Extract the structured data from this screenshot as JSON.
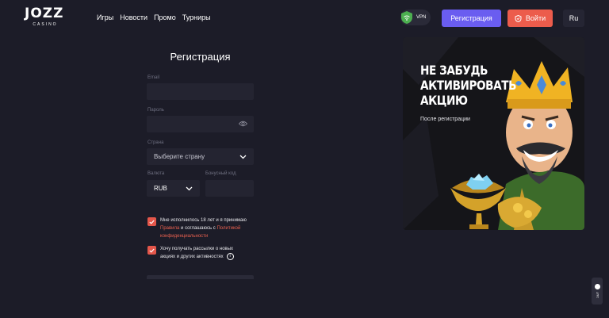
{
  "logo": {
    "main": "JOZZ",
    "sub": "CASINO"
  },
  "nav": [
    "Игры",
    "Новости",
    "Промо",
    "Турниры"
  ],
  "header": {
    "vpn_label": "VPN",
    "register_label": "Регистрация",
    "login_label": "Войти",
    "lang_label": "Ru"
  },
  "form": {
    "title": "Регистрация",
    "email_label": "Email",
    "password_label": "Пароль",
    "country_label": "Страна",
    "country_placeholder": "Выберите страну",
    "currency_label": "Валюта",
    "currency_value": "RUB",
    "bonus_label": "Бонусный код",
    "agree_text_1": "Мне исполнилось 18 лет и я принимаю",
    "agree_link_rules": "Правила",
    "agree_text_2": "и соглашаюсь с",
    "agree_link_policy": "Политикой конфиденциальности",
    "newsletter_text": "Хочу получать рассылки о новых акциях и других активностях"
  },
  "promo": {
    "headline": [
      "НЕ ЗАБУДЬ",
      "АКТИВИРОВАТЬ",
      "АКЦИЮ"
    ],
    "subtext": "После регистрации"
  },
  "chat": {
    "label": "24/7"
  },
  "colors": {
    "background": "#1c1c28",
    "input": "#242431",
    "primary": "#6a5df0",
    "accent": "#ec5c4c",
    "vpn_green": "#4caf50"
  }
}
